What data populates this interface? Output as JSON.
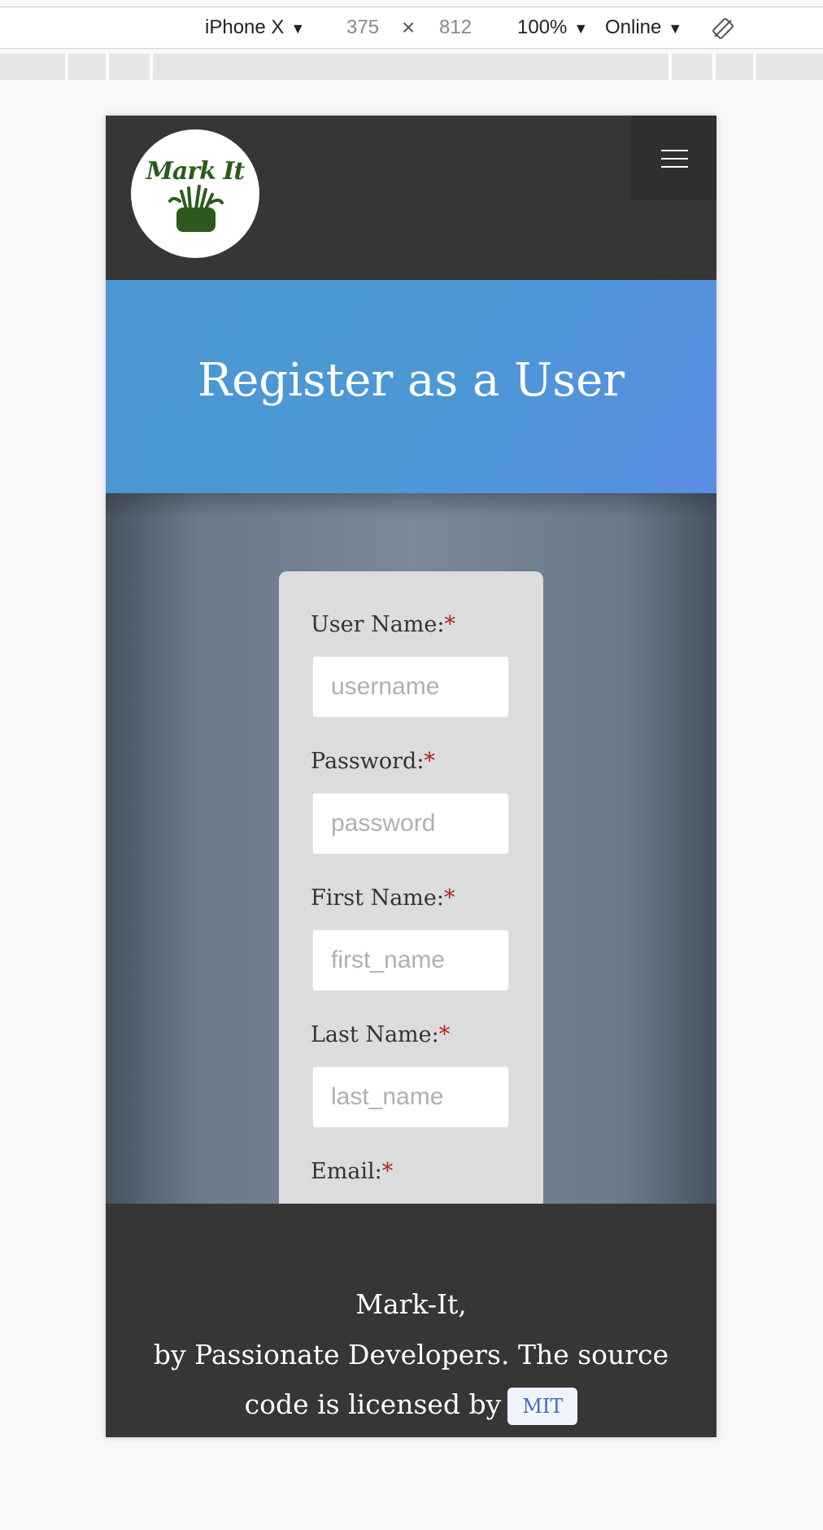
{
  "devtools": {
    "device": "iPhone X",
    "width": "375",
    "times": "×",
    "height": "812",
    "zoom": "100%",
    "network": "Online"
  },
  "navbar": {
    "logo_text": "Mark It"
  },
  "hero": {
    "title": "Register as a User"
  },
  "form": {
    "required_mark": "*",
    "fields": [
      {
        "label": "User Name:",
        "placeholder": "username"
      },
      {
        "label": "Password:",
        "placeholder": "password"
      },
      {
        "label": "First Name:",
        "placeholder": "first_name"
      },
      {
        "label": "Last Name:",
        "placeholder": "last_name"
      },
      {
        "label": "Email:",
        "placeholder": ""
      }
    ]
  },
  "footer": {
    "line1": "Mark-It,",
    "line2": "by Passionate Developers. The source",
    "line3": "code is licensed by",
    "license": "MIT"
  },
  "colors": {
    "navbar": "#363636",
    "hero": "#4a97d1",
    "required": "#b3201e",
    "logo_green": "#2c5a1e"
  }
}
